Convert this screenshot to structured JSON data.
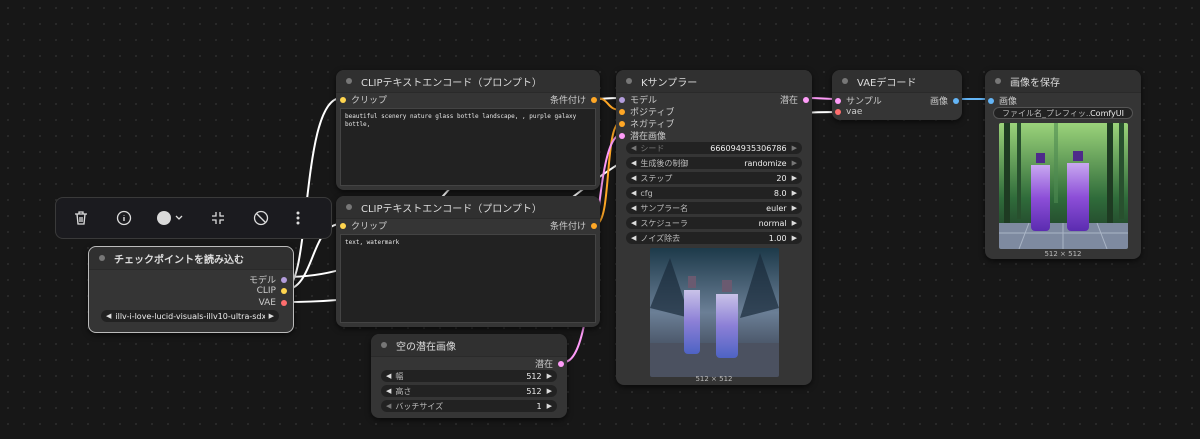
{
  "nodes": {
    "checkpoint": {
      "title": "チェックポイントを読み込む",
      "outputs": {
        "model": "モデル",
        "clip": "CLIP",
        "vae": "VAE"
      },
      "ckpt_name": "illv-i-love-lucid-visuals-illv10-ultra-sdxl.saf..."
    },
    "clip_pos": {
      "title": "CLIPテキストエンコード（プロンプト）",
      "input": "クリップ",
      "output": "条件付け",
      "text": "beautiful scenery nature glass bottle landscape, , purple galaxy bottle,"
    },
    "clip_neg": {
      "title": "CLIPテキストエンコード（プロンプト）",
      "input": "クリップ",
      "output": "条件付け",
      "text": "text, watermark"
    },
    "ksampler": {
      "title": "Kサンプラー",
      "inputs": {
        "model": "モデル",
        "positive": "ポジティブ",
        "negative": "ネガティブ",
        "latent": "潜在画像"
      },
      "output": "潜在",
      "widgets": [
        {
          "label": "シード",
          "value": "666094935306786",
          "disabled": true
        },
        {
          "label": "生成後の制御",
          "value": "randomize",
          "disabled": false
        },
        {
          "label": "ステップ",
          "value": "20",
          "disabled": false
        },
        {
          "label": "cfg",
          "value": "8.0",
          "disabled": false
        },
        {
          "label": "サンプラー名",
          "value": "euler",
          "disabled": false
        },
        {
          "label": "スケジューラ",
          "value": "normal",
          "disabled": false
        },
        {
          "label": "ノイズ除去",
          "value": "1.00",
          "disabled": false
        }
      ],
      "preview_caption": "512 × 512"
    },
    "vae_decode": {
      "title": "VAEデコード",
      "inputs": {
        "samples": "サンプル",
        "vae": "vae"
      },
      "output": "画像"
    },
    "save_image": {
      "title": "画像を保存",
      "input": "画像",
      "prefix_label": "ファイル名_プレフィッ...",
      "prefix_value": "ComfyUI",
      "preview_caption": "512 × 512"
    },
    "empty_latent": {
      "title": "空の潜在画像",
      "output": "潜在",
      "widgets": [
        {
          "label": "幅",
          "value": "512",
          "disabled": false
        },
        {
          "label": "高さ",
          "value": "512",
          "disabled": false
        },
        {
          "label": "バッチサイズ",
          "value": "1",
          "disabled": false
        }
      ]
    }
  },
  "toolbar": {
    "icons": [
      "trash-icon",
      "info-icon",
      "color-circle-icon",
      "collapse-icon",
      "bypass-icon",
      "more-icon"
    ],
    "color_swatch": "#d9d9d9"
  },
  "colors": {
    "background": "#171717",
    "node": "#353535",
    "model": "#b39ddb",
    "clip": "#ffd54f",
    "conditioning": "#ffa726",
    "latent": "#ff9cf9",
    "vae": "#ff6e6e",
    "image": "#64b5f6"
  }
}
